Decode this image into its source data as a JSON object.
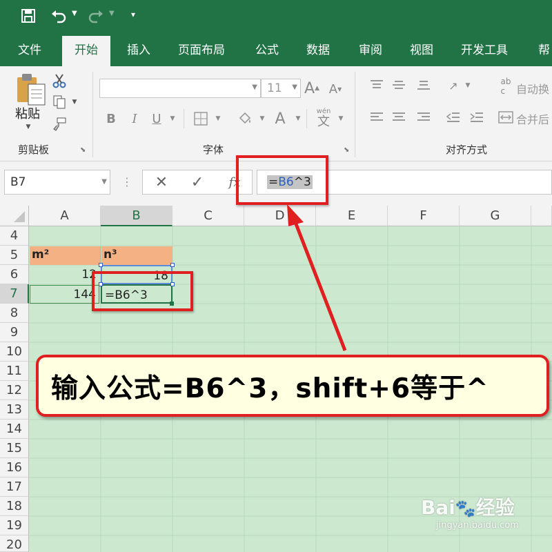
{
  "quick_access": {
    "save_icon": "save-icon",
    "undo_icon": "undo-icon",
    "redo_icon": "redo-icon"
  },
  "tabs": [
    "文件",
    "开始",
    "插入",
    "页面布局",
    "公式",
    "数据",
    "审阅",
    "视图",
    "开发工具",
    "帮"
  ],
  "active_tab": "开始",
  "ribbon": {
    "clipboard": {
      "paste_label": "粘贴",
      "group_label": "剪贴板"
    },
    "font": {
      "font_name": "",
      "font_size": "11",
      "bold": "B",
      "italic": "I",
      "underline": "U",
      "pinyin_top": "wén",
      "pinyin_char": "文",
      "group_label": "字体"
    },
    "alignment": {
      "wrap_text": "自动换",
      "merge": "合并后",
      "group_label": "对齐方式"
    }
  },
  "formula_bar": {
    "name_box": "B7",
    "formula": "=B6^3",
    "formula_ref": "B6",
    "formula_rest": "^3",
    "fx": "fx"
  },
  "columns": [
    "A",
    "B",
    "C",
    "D",
    "E",
    "F",
    "G"
  ],
  "selected_column": "B",
  "rows": [
    "4",
    "5",
    "6",
    "7",
    "8",
    "9",
    "10",
    "11",
    "12",
    "13",
    "14",
    "15",
    "16",
    "17",
    "18",
    "19",
    "20"
  ],
  "selected_row": "7",
  "cells": {
    "A5": "m²",
    "B5": "n³",
    "A6": "12",
    "B6": "18",
    "A7": "144",
    "B7": "=B6^3"
  },
  "annotation": {
    "text": "输入公式=B6^3，shift+6等于^"
  },
  "watermark": {
    "brand": "Bai",
    "brand2": "经验",
    "url": "jingyan.baidu.com"
  },
  "colors": {
    "excel_green": "#217346",
    "header_fill": "#f4b183",
    "grid_bg": "#cce8cf",
    "annotation_red": "#e02020",
    "callout_fill": "#ffffe1"
  }
}
